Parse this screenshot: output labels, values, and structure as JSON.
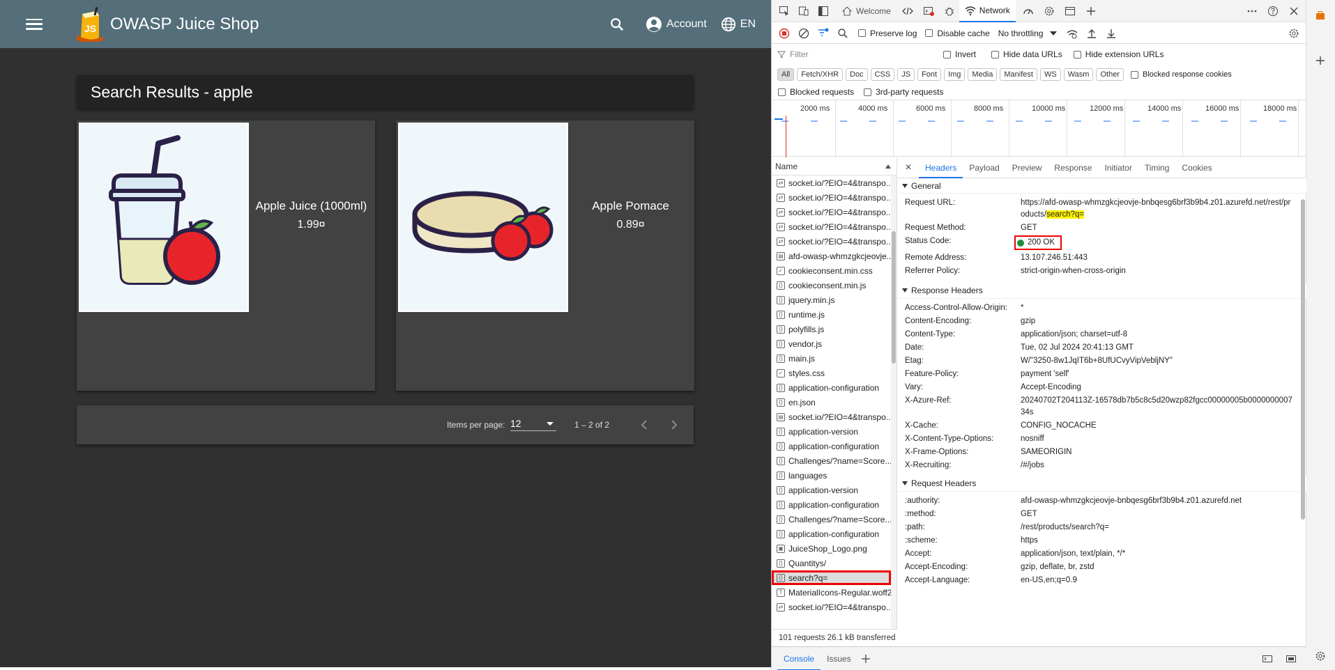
{
  "app": {
    "title": "OWASP Juice Shop",
    "logo_text": "JS",
    "account_label": "Account",
    "language_label": "EN",
    "results_heading": "Search Results - apple",
    "products": [
      {
        "name": "Apple Juice (1000ml)",
        "price": "1.99¤"
      },
      {
        "name": "Apple Pomace",
        "price": "0.89¤"
      }
    ],
    "paginator": {
      "items_per_page_label": "Items per page:",
      "items_per_page_value": "12",
      "range_label": "1 – 2 of 2"
    }
  },
  "devtools": {
    "tabs": [
      "Welcome",
      "Network"
    ],
    "toolbar": {
      "preserve_log": "Preserve log",
      "disable_cache": "Disable cache",
      "throttling": "No throttling"
    },
    "filter": {
      "placeholder": "Filter",
      "invert": "Invert",
      "hide_data_urls": "Hide data URLs",
      "hide_extension_urls": "Hide extension URLs"
    },
    "types": [
      "All",
      "Fetch/XHR",
      "Doc",
      "CSS",
      "JS",
      "Font",
      "Img",
      "Media",
      "Manifest",
      "WS",
      "Wasm",
      "Other"
    ],
    "blocked_response_cookies": "Blocked response cookies",
    "blocked_requests": "Blocked requests",
    "third_party_requests": "3rd-party requests",
    "overview_labels": [
      "2000 ms",
      "4000 ms",
      "6000 ms",
      "8000 ms",
      "10000 ms",
      "12000 ms",
      "14000 ms",
      "16000 ms",
      "18000 ms"
    ],
    "request_list": {
      "header": "Name",
      "rows": [
        {
          "name": "socket.io/?EIO=4&transpo...",
          "icon": "ws"
        },
        {
          "name": "socket.io/?EIO=4&transpo...",
          "icon": "ws"
        },
        {
          "name": "socket.io/?EIO=4&transpo...",
          "icon": "ws"
        },
        {
          "name": "socket.io/?EIO=4&transpo...",
          "icon": "ws"
        },
        {
          "name": "socket.io/?EIO=4&transpo...",
          "icon": "ws"
        },
        {
          "name": "afd-owasp-whmzgkcjeovje...",
          "icon": "doc"
        },
        {
          "name": "cookieconsent.min.css",
          "icon": "css"
        },
        {
          "name": "cookieconsent.min.js",
          "icon": "js"
        },
        {
          "name": "jquery.min.js",
          "icon": "js"
        },
        {
          "name": "runtime.js",
          "icon": "js"
        },
        {
          "name": "polyfills.js",
          "icon": "js"
        },
        {
          "name": "vendor.js",
          "icon": "js"
        },
        {
          "name": "main.js",
          "icon": "js"
        },
        {
          "name": "styles.css",
          "icon": "css"
        },
        {
          "name": "application-configuration",
          "icon": "xhr"
        },
        {
          "name": "en.json",
          "icon": "xhr"
        },
        {
          "name": "socket.io/?EIO=4&transpo...",
          "icon": "doc"
        },
        {
          "name": "application-version",
          "icon": "xhr"
        },
        {
          "name": "application-configuration",
          "icon": "xhr"
        },
        {
          "name": "Challenges/?name=Score...",
          "icon": "xhr"
        },
        {
          "name": "languages",
          "icon": "xhr"
        },
        {
          "name": "application-version",
          "icon": "xhr"
        },
        {
          "name": "application-configuration",
          "icon": "xhr"
        },
        {
          "name": "Challenges/?name=Score...",
          "icon": "xhr"
        },
        {
          "name": "application-configuration",
          "icon": "xhr"
        },
        {
          "name": "JuiceShop_Logo.png",
          "icon": "img"
        },
        {
          "name": "Quantitys/",
          "icon": "xhr"
        },
        {
          "name": "search?q=",
          "icon": "xhr",
          "selected": true
        },
        {
          "name": "MaterialIcons-Regular.woff2",
          "icon": "font"
        },
        {
          "name": "socket.io/?EIO=4&transpo...",
          "icon": "ws"
        }
      ],
      "summary": "101 requests  26.1 kB transferred"
    },
    "details": {
      "tabs": [
        "Headers",
        "Payload",
        "Preview",
        "Response",
        "Initiator",
        "Timing",
        "Cookies"
      ],
      "general_title": "General",
      "general": {
        "request_url_key": "Request URL:",
        "request_url_prefix": "https://afd-owasp-whmzgkcjeovje-bnbqesg6brf3b9b4.z01.azurefd.net/rest/products/",
        "request_url_highlight": "search?q=",
        "method_key": "Request Method:",
        "method": "GET",
        "status_key": "Status Code:",
        "status": "200 OK",
        "remote_key": "Remote Address:",
        "remote": "13.107.246.51:443",
        "referrer_key": "Referrer Policy:",
        "referrer": "strict-origin-when-cross-origin"
      },
      "response_title": "Response Headers",
      "response_headers": [
        {
          "k": "Access-Control-Allow-Origin:",
          "v": "*"
        },
        {
          "k": "Content-Encoding:",
          "v": "gzip"
        },
        {
          "k": "Content-Type:",
          "v": "application/json; charset=utf-8"
        },
        {
          "k": "Date:",
          "v": "Tue, 02 Jul 2024 20:41:13 GMT"
        },
        {
          "k": "Etag:",
          "v": "W/\"3250-8w1JqIT6b+8UfUCvyVipVebljNY\""
        },
        {
          "k": "Feature-Policy:",
          "v": "payment 'self'"
        },
        {
          "k": "Vary:",
          "v": "Accept-Encoding"
        },
        {
          "k": "X-Azure-Ref:",
          "v": "20240702T204113Z-16578db7b5c8c5d20wzp82fgcc00000005b000000000734s"
        },
        {
          "k": "X-Cache:",
          "v": "CONFIG_NOCACHE"
        },
        {
          "k": "X-Content-Type-Options:",
          "v": "nosniff"
        },
        {
          "k": "X-Frame-Options:",
          "v": "SAMEORIGIN"
        },
        {
          "k": "X-Recruiting:",
          "v": "/#/jobs"
        }
      ],
      "request_title": "Request Headers",
      "request_headers": [
        {
          "k": ":authority:",
          "v": "afd-owasp-whmzgkcjeovje-bnbqesg6brf3b9b4.z01.azurefd.net"
        },
        {
          "k": ":method:",
          "v": "GET"
        },
        {
          "k": ":path:",
          "v": "/rest/products/search?q="
        },
        {
          "k": ":scheme:",
          "v": "https"
        },
        {
          "k": "Accept:",
          "v": "application/json, text/plain, */*"
        },
        {
          "k": "Accept-Encoding:",
          "v": "gzip, deflate, br, zstd"
        },
        {
          "k": "Accept-Language:",
          "v": "en-US,en;q=0.9"
        }
      ]
    },
    "drawer_tabs": [
      "Console",
      "Issues"
    ]
  }
}
